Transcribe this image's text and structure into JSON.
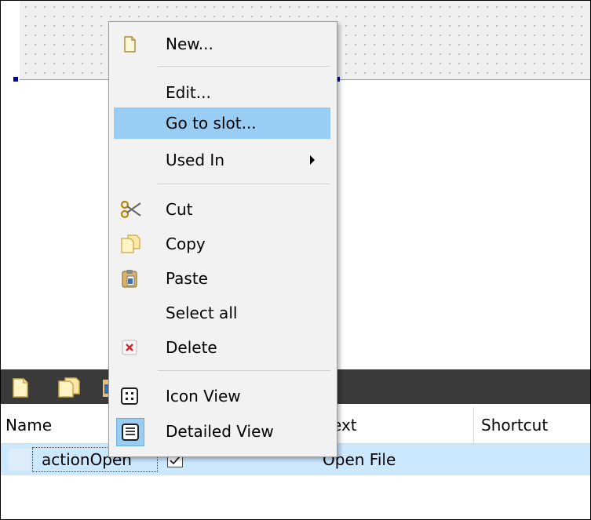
{
  "menu": {
    "items": [
      {
        "label": "New...",
        "icon": "new-document-icon"
      },
      {
        "label": "Edit..."
      },
      {
        "label": "Go to slot...",
        "highlighted": true
      },
      {
        "label": "Used In",
        "has_submenu": true
      },
      {
        "label": "Cut",
        "icon": "scissors-icon"
      },
      {
        "label": "Copy",
        "icon": "copy-icon"
      },
      {
        "label": "Paste",
        "icon": "paste-icon"
      },
      {
        "label": "Select all"
      },
      {
        "label": "Delete",
        "icon": "delete-icon"
      },
      {
        "label": "Icon View",
        "icon": "icon-view-icon"
      },
      {
        "label": "Detailed View",
        "icon": "detailed-view-icon",
        "checked": true
      }
    ]
  },
  "table": {
    "columns": [
      "Name",
      "ext",
      "Shortcut"
    ],
    "rows": [
      {
        "name": "actionOpen",
        "used": true,
        "text": "Open File",
        "shortcut": ""
      }
    ]
  },
  "colors": {
    "highlight": "#99cdf4",
    "selected_row": "#cce8ff",
    "toolbar": "#3a3a3a"
  }
}
